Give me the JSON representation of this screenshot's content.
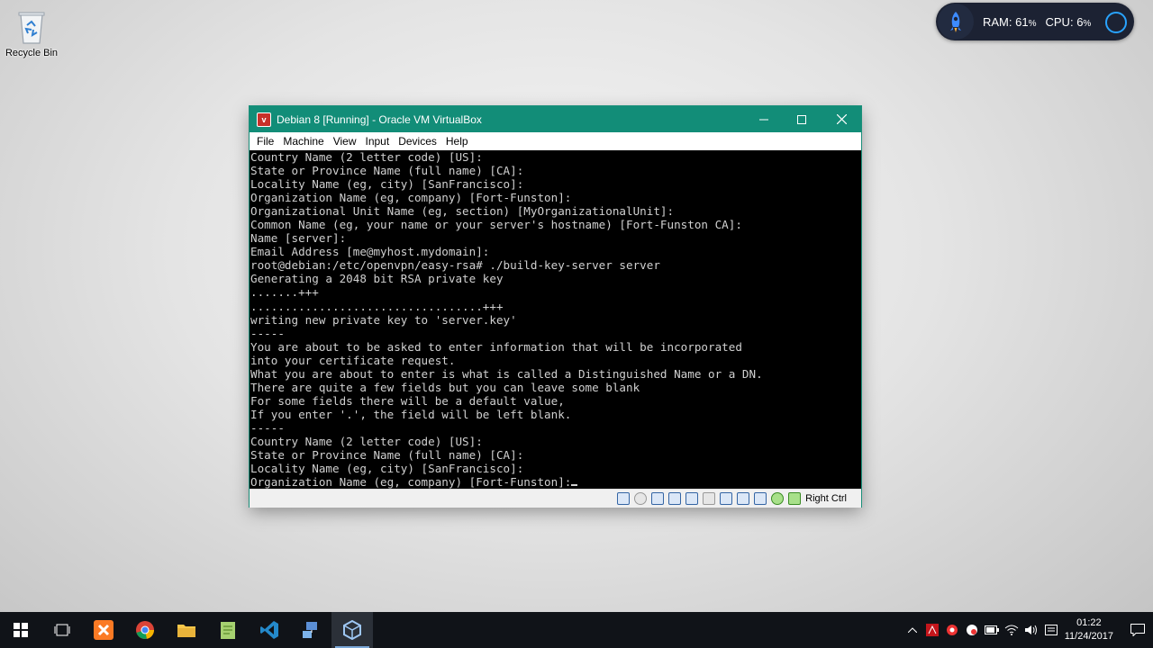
{
  "desktop": {
    "recycle_bin_label": "Recycle Bin"
  },
  "monitor": {
    "ram_label": "RAM:",
    "ram_value": "61",
    "cpu_label": "CPU:",
    "cpu_value": "6",
    "percent": "%"
  },
  "window": {
    "title": "Debian 8 [Running] - Oracle VM VirtualBox",
    "menu": [
      "File",
      "Machine",
      "View",
      "Input",
      "Devices",
      "Help"
    ],
    "host_key": "Right Ctrl",
    "terminal_lines": [
      "Country Name (2 letter code) [US]:",
      "State or Province Name (full name) [CA]:",
      "Locality Name (eg, city) [SanFrancisco]:",
      "Organization Name (eg, company) [Fort-Funston]:",
      "Organizational Unit Name (eg, section) [MyOrganizationalUnit]:",
      "Common Name (eg, your name or your server's hostname) [Fort-Funston CA]:",
      "Name [server]:",
      "Email Address [me@myhost.mydomain]:",
      "root@debian:/etc/openvpn/easy-rsa# ./build-key-server server",
      "Generating a 2048 bit RSA private key",
      ".......+++",
      "..................................+++",
      "writing new private key to 'server.key'",
      "-----",
      "You are about to be asked to enter information that will be incorporated",
      "into your certificate request.",
      "What you are about to enter is what is called a Distinguished Name or a DN.",
      "There are quite a few fields but you can leave some blank",
      "For some fields there will be a default value,",
      "If you enter '.', the field will be left blank.",
      "-----",
      "Country Name (2 letter code) [US]:",
      "State or Province Name (full name) [CA]:",
      "Locality Name (eg, city) [SanFrancisco]:",
      "Organization Name (eg, company) [Fort-Funston]:"
    ]
  },
  "taskbar": {
    "apps": [
      "start-icon",
      "task-view-icon",
      "xampp-icon",
      "chrome-icon",
      "file-explorer-icon",
      "notepad-icon",
      "vscode-icon",
      "network-tool-icon",
      "virtualbox-icon"
    ],
    "time": "01:22",
    "date": "11/24/2017"
  },
  "colors": {
    "title_bar": "#128d78",
    "terminal_bg": "#000000",
    "terminal_fg": "#d0d0d0",
    "taskbar": "#101318"
  }
}
